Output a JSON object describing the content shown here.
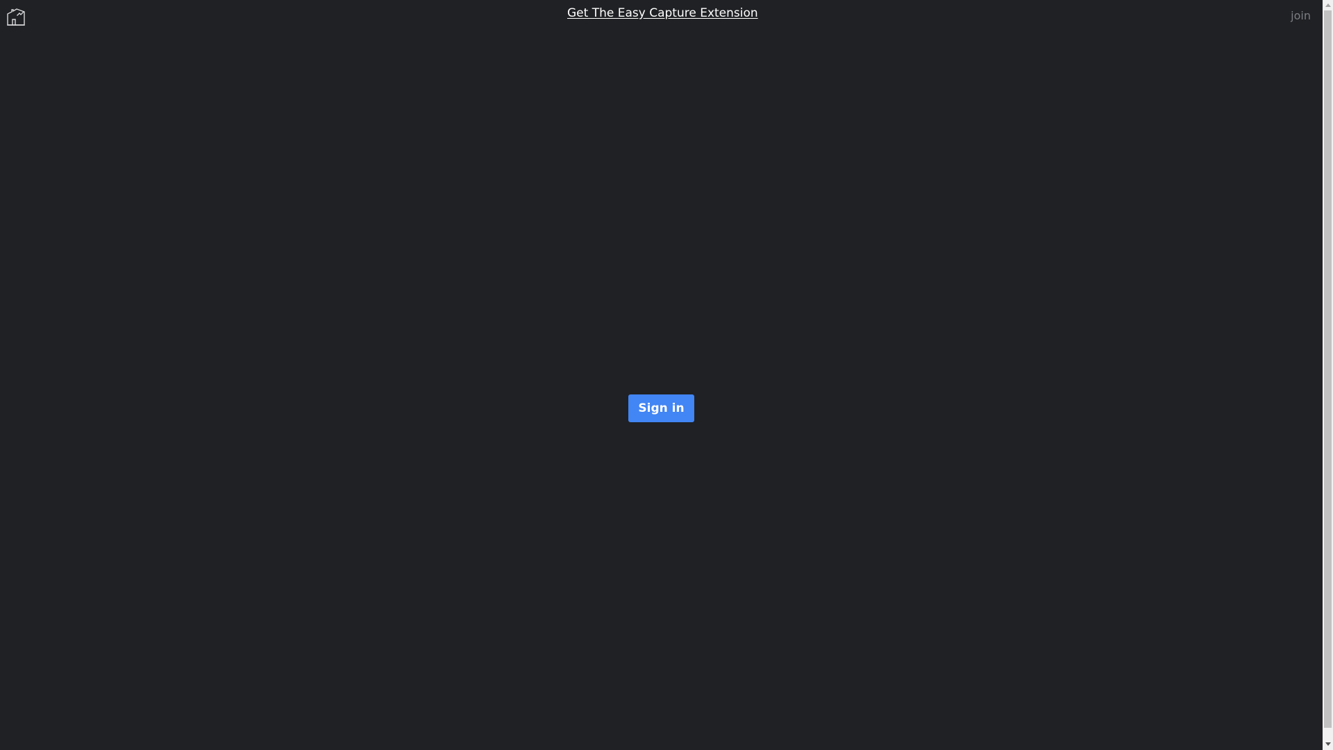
{
  "header": {
    "logo_icon": "house-chart-icon",
    "extension_link": "Get The Easy Capture Extension",
    "join_link": "join"
  },
  "main": {
    "signin_label": "Sign in"
  },
  "colors": {
    "background": "#202124",
    "accent": "#4285f4",
    "muted_text": "#7b7e84"
  }
}
